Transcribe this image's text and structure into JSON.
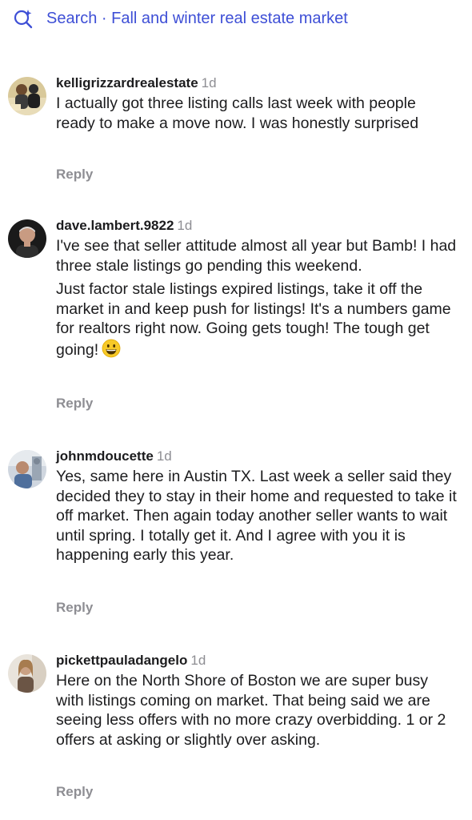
{
  "search": {
    "icon": "search-sparkle-icon",
    "label": "Search · Fall and winter real estate market",
    "color": "#3e4fd6"
  },
  "comments": [
    {
      "username": "kelligrizzardrealestate",
      "time": "1d",
      "paragraphs": [
        "I actually got three listing calls last week with people ready to make a move now. I was honestly surprised"
      ],
      "reply": "Reply"
    },
    {
      "username": "dave.lambert.9822",
      "time": "1d",
      "paragraphs": [
        "I've see that seller attitude almost all year but Bamb! I had three stale listings go pending this weekend.",
        "Just factor stale listings expired listings, take it off the market in and keep push for listings! It's a numbers game for realtors right now. Going gets tough! The tough get going!"
      ],
      "emoji": "grinning-face-emoji",
      "reply": "Reply"
    },
    {
      "username": "johnmdoucette",
      "time": "1d",
      "paragraphs": [
        "Yes, same here in Austin TX. Last week a seller said they decided they to stay in their home and requested to take it off market. Then again today another seller wants to wait until spring. I totally get it. And I agree with you it is happening early this year."
      ],
      "reply": "Reply"
    },
    {
      "username": "pickettpauladangelo",
      "time": "1d",
      "paragraphs": [
        "Here on the North Shore of Boston we are super busy with listings coming on market. That being said we are seeing less offers with no more crazy overbidding. 1 or 2 offers at asking or slightly over asking."
      ],
      "reply": "Reply"
    }
  ]
}
